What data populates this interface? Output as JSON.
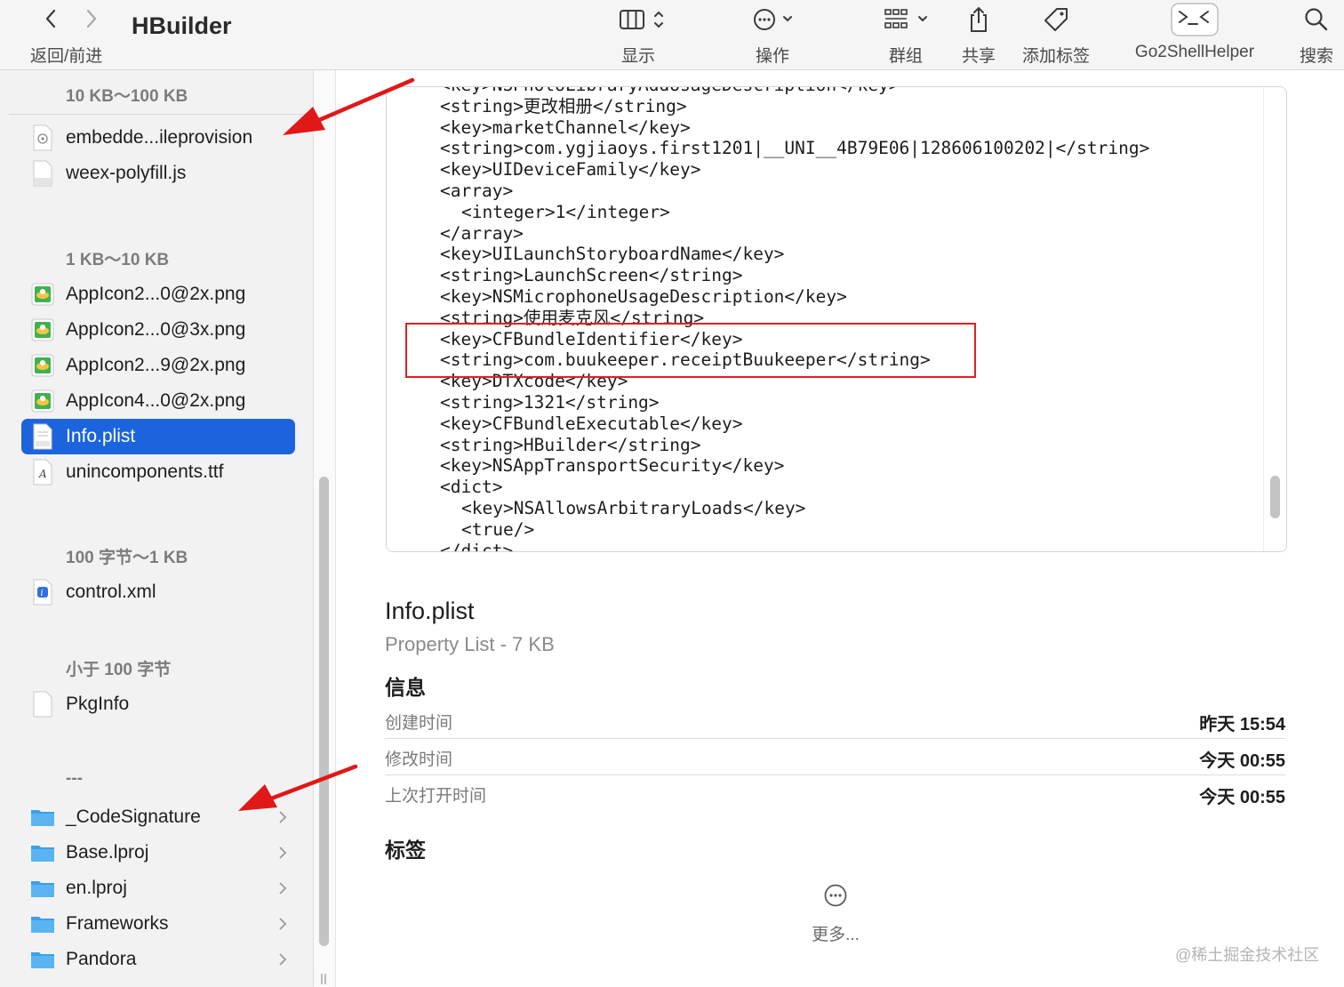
{
  "toolbar": {
    "title": "HBuilder",
    "nav_label": "返回/前进",
    "items": [
      {
        "label": "显示",
        "icon": "column-view-icon"
      },
      {
        "label": "操作",
        "icon": "ellipsis-circle-icon"
      },
      {
        "label": "群组",
        "icon": "grid-group-icon"
      },
      {
        "label": "共享",
        "icon": "share-icon"
      },
      {
        "label": "添加标签",
        "icon": "tag-icon"
      },
      {
        "label": "Go2ShellHelper",
        "icon": "terminal-icon"
      },
      {
        "label": "搜索",
        "icon": "search-icon"
      }
    ]
  },
  "sidebar": {
    "groups": [
      {
        "header": "10 KB～100 KB",
        "files": [
          {
            "name": "embedde...ileprovision",
            "icon": "provision-file-icon"
          },
          {
            "name": "weex-polyfill.js",
            "icon": "js-file-icon"
          }
        ]
      },
      {
        "header": "1 KB～10 KB",
        "files": [
          {
            "name": "AppIcon2...0@2x.png",
            "icon": "png-file-icon"
          },
          {
            "name": "AppIcon2...0@3x.png",
            "icon": "png-file-icon"
          },
          {
            "name": "AppIcon2...9@2x.png",
            "icon": "png-file-icon"
          },
          {
            "name": "AppIcon4...0@2x.png",
            "icon": "png-file-icon"
          },
          {
            "name": "Info.plist",
            "icon": "plist-file-icon",
            "selected": true
          },
          {
            "name": "unincomponents.ttf",
            "icon": "font-file-icon"
          }
        ]
      },
      {
        "header": "100 字节～1 KB",
        "files": [
          {
            "name": "control.xml",
            "icon": "xml-file-icon"
          }
        ]
      },
      {
        "header": "小于 100 字节",
        "files": [
          {
            "name": "PkgInfo",
            "icon": "blank-file-icon"
          }
        ]
      },
      {
        "header": "---",
        "files": [
          {
            "name": "_CodeSignature",
            "icon": "folder-icon"
          },
          {
            "name": "Base.lproj",
            "icon": "folder-icon"
          },
          {
            "name": "en.lproj",
            "icon": "folder-icon"
          },
          {
            "name": "Frameworks",
            "icon": "folder-icon"
          },
          {
            "name": "Pandora",
            "icon": "folder-icon"
          }
        ]
      }
    ]
  },
  "preview": {
    "lines": [
      {
        "text": "<key>NSPhotoLibraryAddUsageDescription</key>",
        "indent": 0
      },
      {
        "text": "<string>更改相册</string>",
        "indent": 0
      },
      {
        "text": "<key>marketChannel</key>",
        "indent": 0
      },
      {
        "text": "<string>com.ygjiaoys.first1201|__UNI__4B79E06|128606100202|</string>",
        "indent": 0
      },
      {
        "text": "<key>UIDeviceFamily</key>",
        "indent": 0
      },
      {
        "text": "<array>",
        "indent": 0
      },
      {
        "text": "<integer>1</integer>",
        "indent": 1
      },
      {
        "text": "</array>",
        "indent": 0
      },
      {
        "text": "<key>UILaunchStoryboardName</key>",
        "indent": 0
      },
      {
        "text": "<string>LaunchScreen</string>",
        "indent": 0
      },
      {
        "text": "<key>NSMicrophoneUsageDescription</key>",
        "indent": 0
      },
      {
        "text": "<string>使用麦克风</string>",
        "indent": 0
      },
      {
        "text": "<key>CFBundleIdentifier</key>",
        "indent": 0
      },
      {
        "text": "<string>com.buukeeper.receiptBuukeeper</string>",
        "indent": 0
      },
      {
        "text": "<key>DTXcode</key>",
        "indent": 0
      },
      {
        "text": "<string>1321</string>",
        "indent": 0
      },
      {
        "text": "<key>CFBundleExecutable</key>",
        "indent": 0
      },
      {
        "text": "<string>HBuilder</string>",
        "indent": 0
      },
      {
        "text": "<key>NSAppTransportSecurity</key>",
        "indent": 0
      },
      {
        "text": "<dict>",
        "indent": 0
      },
      {
        "text": "<key>NSAllowsArbitraryLoads</key>",
        "indent": 1
      },
      {
        "text": "<true/>",
        "indent": 1
      },
      {
        "text": "</dict>",
        "indent": 0
      }
    ]
  },
  "info": {
    "file_name": "Info.plist",
    "file_kind": "Property List - 7 KB",
    "section_info": "信息",
    "rows": [
      {
        "key": "创建时间",
        "value": "昨天 15:54"
      },
      {
        "key": "修改时间",
        "value": "今天 00:55"
      },
      {
        "key": "上次打开时间",
        "value": "今天 00:55"
      }
    ],
    "section_tags": "标签",
    "more_label": "更多..."
  },
  "watermark": "@稀土掘金技术社区",
  "colors": {
    "selection": "#1c64dd",
    "annotation": "#e02020",
    "folder": "#3aa0ea"
  }
}
